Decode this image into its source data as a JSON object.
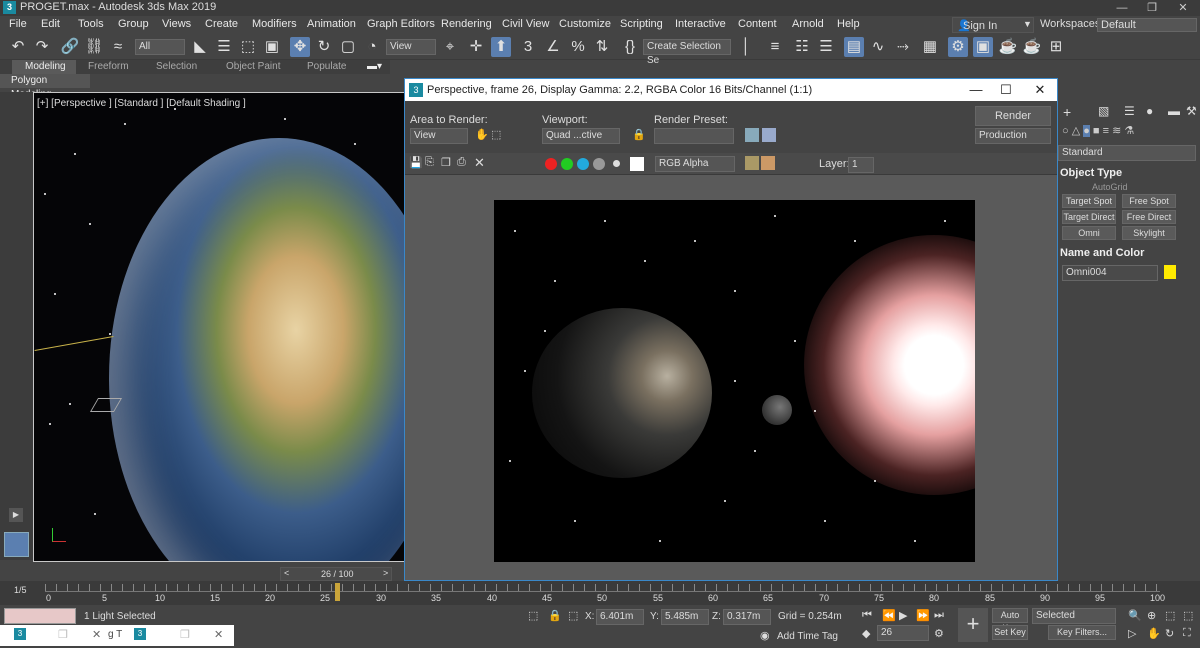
{
  "title": "PROGET.max - Autodesk 3ds Max 2019",
  "app_icon": "3",
  "menu": [
    "File",
    "Edit",
    "Tools",
    "Group",
    "Views",
    "Create",
    "Modifiers",
    "Animation",
    "Graph Editors",
    "Rendering",
    "Civil View",
    "Customize",
    "Scripting",
    "Interactive",
    "Content",
    "Arnold",
    "Help"
  ],
  "sign_in": "Sign In",
  "workspaces_label": "Workspaces:",
  "workspace_value": "Default",
  "toolbar": {
    "filter": "All",
    "view": "View",
    "selection_set": "Create Selection Se"
  },
  "ribbon_tabs": [
    "Modeling",
    "Freeform",
    "Selection",
    "Object Paint",
    "Populate"
  ],
  "ribbon_sub": "Polygon Modeling",
  "viewport_label": "[+] [Perspective ] [Standard ] [Default Shading ]",
  "frame_slider": "26 / 100",
  "render_window": {
    "title": "Perspective, frame 26, Display Gamma: 2.2, RGBA Color 16 Bits/Channel (1:1)",
    "area_to_render_label": "Area to Render:",
    "area_to_render_value": "View",
    "viewport_label": "Viewport:",
    "viewport_value": "Quad ...ctive",
    "render_preset_label": "Render Preset:",
    "render_preset_value": "",
    "render_button": "Render",
    "production": "Production",
    "channel": "RGB Alpha",
    "layer_label": "Layer:",
    "layer_value": "1"
  },
  "command_panel": {
    "dropdown": "Standard",
    "object_type": "Object Type",
    "autogrid": "AutoGrid",
    "buttons": [
      "Target Spot",
      "Free Spot",
      "Target Direct",
      "Free Direct",
      "Omni",
      "Skylight"
    ],
    "name_color": "Name and Color",
    "object_name": "Omni004",
    "object_color": "#ffea00"
  },
  "timeline_ticks": [
    "0",
    "5",
    "10",
    "15",
    "20",
    "25",
    "30",
    "35",
    "40",
    "45",
    "50",
    "55",
    "60",
    "65",
    "70",
    "75",
    "80",
    "85",
    "90",
    "95",
    "100"
  ],
  "timeline_toggle": "1/5",
  "status": {
    "selection": "1 Light Selected",
    "x": "6.401m",
    "y": "5.485m",
    "z": "0.317m",
    "grid": "Grid = 0.254m",
    "add_time_tag": "Add Time Tag",
    "auto_key": "Auto Key",
    "set_key": "Set Key",
    "selected": "Selected",
    "key_filters": "Key Filters...",
    "frame": "26"
  },
  "taskbar_tab1": "",
  "taskbar_tab2_fragment": "g T"
}
